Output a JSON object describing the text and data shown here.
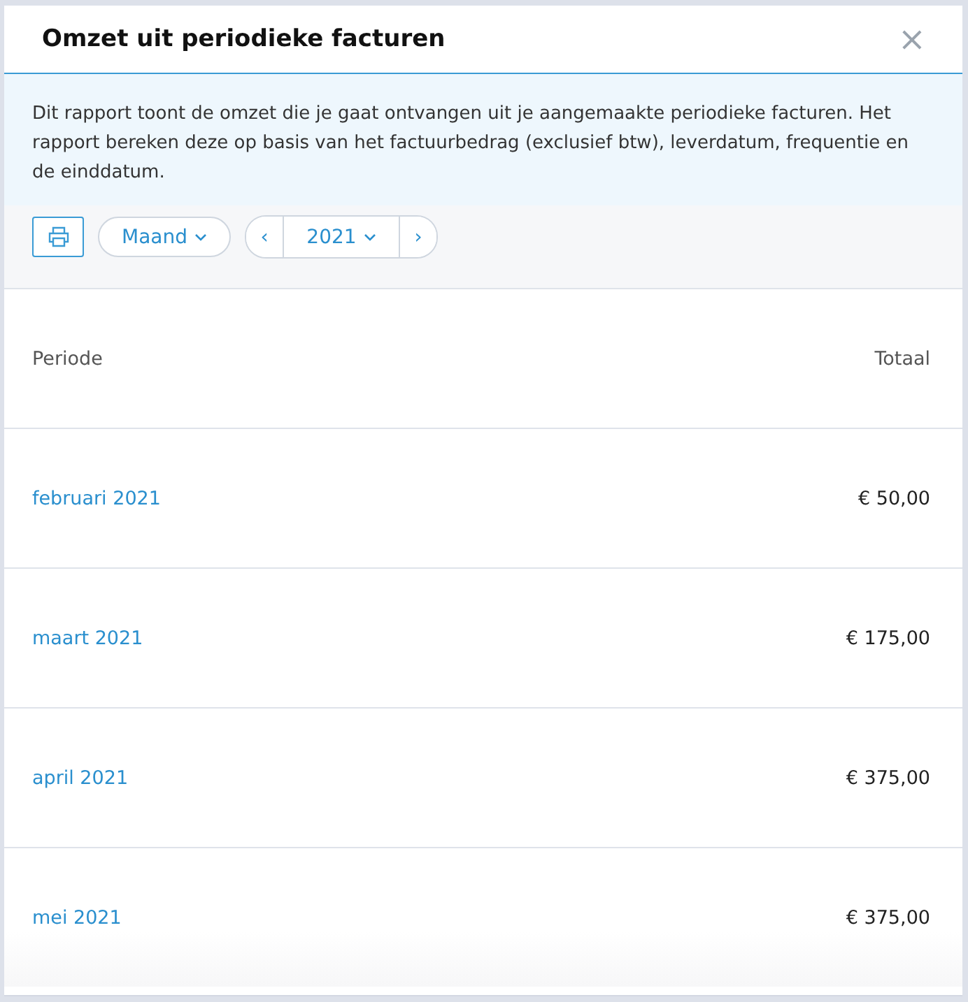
{
  "dialog": {
    "title": "Omzet uit periodieke facturen",
    "close": "×"
  },
  "description": "Dit rapport toont de omzet die je gaat ontvangen uit je aangemaakte periodieke facturen. Het rapport bereken deze op basis van het factuurbedrag (exclusief btw), leverdatum, frequentie en de einddatum.",
  "toolbar": {
    "period": "Maand",
    "prev": "‹",
    "year": "2021",
    "next": "›"
  },
  "table": {
    "columns": [
      "Periode",
      "Totaal"
    ],
    "rows": [
      {
        "period": "februari 2021",
        "total": "€ 50,00"
      },
      {
        "period": "maart 2021",
        "total": "€ 175,00"
      },
      {
        "period": "april 2021",
        "total": "€ 375,00"
      },
      {
        "period": "mei 2021",
        "total": "€ 375,00"
      }
    ]
  }
}
